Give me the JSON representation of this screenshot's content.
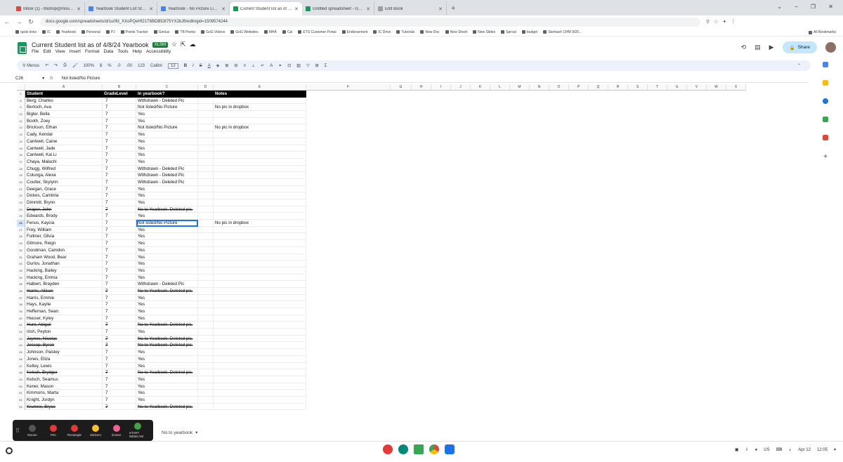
{
  "browser": {
    "tabs": [
      {
        "title": "Inbox (1) - lbishop@mountain…",
        "color": "#ea4335",
        "active": false
      },
      {
        "title": "Yearbook Student List Steps -",
        "color": "#4285f4",
        "active": false
      },
      {
        "title": "Yearbook - No Picture List - Go",
        "color": "#4285f4",
        "active": false
      },
      {
        "title": "Current Student list as of 4/8/2…",
        "color": "#0f9d58",
        "active": true
      },
      {
        "title": "Untitled spreadsheet - Google S",
        "color": "#0f9d58",
        "active": false
      },
      {
        "title": "Edit Book",
        "color": "#9e9e9e",
        "active": false
      }
    ],
    "url": "docs.google.com/spreadsheets/d/1u0fd_XXoPQeHf21T6BDB53t75YX2bJft/edit#gid=1509574244",
    "bookmarks": [
      "quick links",
      "IC",
      "Yearbook",
      "Personal",
      "PJ",
      "Points Tracker",
      "Genius",
      "TB Points",
      "GoG Videos",
      "GoG Websites",
      "MHA",
      "Cal",
      "ETS Customer Portal",
      "Endorsement",
      "IC Drive",
      "Tutorials",
      "New Doc",
      "New Sheet",
      "New Slides",
      "Sprout",
      "budget",
      "Stomach CHM 9/20..."
    ],
    "all_bookmarks": "All Bookmarks"
  },
  "doc": {
    "title": "Current Student list as of 4/8/24 Yearbook",
    "badge": "XLSM",
    "menus": [
      "File",
      "Edit",
      "View",
      "Insert",
      "Format",
      "Data",
      "Tools",
      "Help",
      "Accessibility"
    ],
    "share_label": "Share"
  },
  "toolbar": {
    "menus": "Menus",
    "zoom": "100%",
    "currency": "$",
    "percent": "%",
    "dec_less": ".0",
    "dec_more": ".00",
    "num": "123",
    "font": "Calibri",
    "font_size": "12"
  },
  "formula": {
    "cell_ref": "C26",
    "fx": "fx",
    "value": "Not listed/No Picture"
  },
  "columns": [
    "A",
    "B",
    "C",
    "D",
    "E",
    "F",
    "G",
    "H",
    "I",
    "J",
    "K",
    "L",
    "M",
    "N",
    "O",
    "P",
    "Q",
    "R",
    "S",
    "T",
    "U",
    "V",
    "W",
    "X"
  ],
  "header_row": {
    "num": "1",
    "cells": [
      "Student",
      "GradeLevel",
      "In yearbook?",
      "",
      "Notes"
    ]
  },
  "rows": [
    {
      "num": "8",
      "name": "Berg, Charles",
      "grade": "7",
      "yb": "Withdrawn - Deleted Pic",
      "notes": "",
      "strike": false
    },
    {
      "num": "9",
      "name": "Bertoch, Ava",
      "grade": "7",
      "yb": "Not listed/No Picture",
      "notes": "No pic in dropbox",
      "strike": false
    },
    {
      "num": "10",
      "name": "Bigler, Bella",
      "grade": "7",
      "yb": "Yes",
      "notes": "",
      "strike": false
    },
    {
      "num": "11",
      "name": "Booth, Zoey",
      "grade": "7",
      "yb": "Yes",
      "notes": "",
      "strike": false
    },
    {
      "num": "12",
      "name": "Brickson, Ethan",
      "grade": "7",
      "yb": "Not listed/No Picture",
      "notes": "No pic in dropbox",
      "strike": false
    },
    {
      "num": "13",
      "name": "Cady, Kendal",
      "grade": "7",
      "yb": "Yes",
      "notes": "",
      "strike": false
    },
    {
      "num": "14",
      "name": "Cantwell, Caine",
      "grade": "7",
      "yb": "Yes",
      "notes": "",
      "strike": false
    },
    {
      "num": "15",
      "name": "Cantwell, Jade",
      "grade": "7",
      "yb": "Yes",
      "notes": "",
      "strike": false
    },
    {
      "num": "16",
      "name": "Cantwell, Kai Li",
      "grade": "7",
      "yb": "Yes",
      "notes": "",
      "strike": false
    },
    {
      "num": "17",
      "name": "Chaya, Malachi",
      "grade": "7",
      "yb": "Yes",
      "notes": "",
      "strike": false
    },
    {
      "num": "18",
      "name": "Chugg, Wilfred",
      "grade": "7",
      "yb": "Withdrawn - Deleted Pic",
      "notes": "",
      "strike": false
    },
    {
      "num": "19",
      "name": "Colunga, Alexa",
      "grade": "7",
      "yb": "Withdrawn - Deleted Pic",
      "notes": "",
      "strike": false
    },
    {
      "num": "20",
      "name": "Coulter, Skylynn",
      "grade": "7",
      "yb": "Withdrawn - Deleted Pic",
      "notes": "",
      "strike": false
    },
    {
      "num": "21",
      "name": "Deegan, Grace",
      "grade": "7",
      "yb": "Yes",
      "notes": "",
      "strike": false
    },
    {
      "num": "22",
      "name": "Dickes, Cambria",
      "grade": "7",
      "yb": "Yes",
      "notes": "",
      "strike": false
    },
    {
      "num": "23",
      "name": "Dimmitt, Brynn",
      "grade": "7",
      "yb": "Yes",
      "notes": "",
      "strike": false
    },
    {
      "num": "24",
      "name": "Draper, John",
      "grade": "7",
      "yb": "No to Yearbook. Deleted pic.",
      "notes": "",
      "strike": true
    },
    {
      "num": "25",
      "name": "Edwards, Brody",
      "grade": "7",
      "yb": "Yes",
      "notes": "",
      "strike": false
    },
    {
      "num": "26",
      "name": "Fenus, Kaycia",
      "grade": "7",
      "yb": "Not listed/No Picture",
      "notes": "No pic in dropbox",
      "strike": false
    },
    {
      "num": "27",
      "name": "Frey, William",
      "grade": "7",
      "yb": "Yes",
      "notes": "",
      "strike": false
    },
    {
      "num": "28",
      "name": "Fullmer, Olivia",
      "grade": "7",
      "yb": "Yes",
      "notes": "",
      "strike": false
    },
    {
      "num": "29",
      "name": "Gilmore, Reign",
      "grade": "7",
      "yb": "Yes",
      "notes": "",
      "strike": false
    },
    {
      "num": "30",
      "name": "Goodman, Camdon",
      "grade": "7",
      "yb": "Yes",
      "notes": "",
      "strike": false
    },
    {
      "num": "31",
      "name": "Graham Wood, Bear",
      "grade": "7",
      "yb": "Yes",
      "notes": "",
      "strike": false
    },
    {
      "num": "32",
      "name": "Gurlov, Jonathan",
      "grade": "7",
      "yb": "Yes",
      "notes": "",
      "strike": false
    },
    {
      "num": "33",
      "name": "Hacking, Bailey",
      "grade": "7",
      "yb": "Yes",
      "notes": "",
      "strike": false
    },
    {
      "num": "34",
      "name": "Hacking, Emma",
      "grade": "7",
      "yb": "Yes",
      "notes": "",
      "strike": false
    },
    {
      "num": "35",
      "name": "Halbert, Brayden",
      "grade": "7",
      "yb": "Withdrawn - Deleted Pic",
      "notes": "",
      "strike": false
    },
    {
      "num": "36",
      "name": "Harris, Allison",
      "grade": "7",
      "yb": "No to Yearbook. Deleted pic.",
      "notes": "",
      "strike": true
    },
    {
      "num": "37",
      "name": "Harris, Emmie",
      "grade": "7",
      "yb": "Yes",
      "notes": "",
      "strike": false
    },
    {
      "num": "38",
      "name": "Hays, Kaylie",
      "grade": "7",
      "yb": "Yes",
      "notes": "",
      "strike": false
    },
    {
      "num": "39",
      "name": "Heffernan, Sean",
      "grade": "7",
      "yb": "Yes",
      "notes": "",
      "strike": false
    },
    {
      "num": "40",
      "name": "Heuser, Kyley",
      "grade": "7",
      "yb": "Yes",
      "notes": "",
      "strike": false
    },
    {
      "num": "41",
      "name": "Hunt, Abigail",
      "grade": "7",
      "yb": "No to Yearbook. Deleted pic.",
      "notes": "",
      "strike": true
    },
    {
      "num": "42",
      "name": "Irish, Peyton",
      "grade": "7",
      "yb": "Yes",
      "notes": "",
      "strike": false
    },
    {
      "num": "43",
      "name": "Jaynes, Nicolas",
      "grade": "7",
      "yb": "No to Yearbook. Deleted pic.",
      "notes": "",
      "strike": true
    },
    {
      "num": "44",
      "name": "Jessop, Byron",
      "grade": "7",
      "yb": "No to Yearbook. Deleted pic.",
      "notes": "",
      "strike": true
    },
    {
      "num": "45",
      "name": "Johnson, Paisley",
      "grade": "7",
      "yb": "Yes",
      "notes": "",
      "strike": false
    },
    {
      "num": "46",
      "name": "Jones, Eliza",
      "grade": "7",
      "yb": "Yes",
      "notes": "",
      "strike": false
    },
    {
      "num": "47",
      "name": "Kelley, Lewis",
      "grade": "7",
      "yb": "Yes",
      "notes": "",
      "strike": false
    },
    {
      "num": "48",
      "name": "Kelsch, Brydger",
      "grade": "7",
      "yb": "No to Yearbook. Deleted pic.",
      "notes": "",
      "strike": true
    },
    {
      "num": "49",
      "name": "Kelsch, Seamus",
      "grade": "7",
      "yb": "Yes",
      "notes": "",
      "strike": false
    },
    {
      "num": "50",
      "name": "Kener, Mason",
      "grade": "7",
      "yb": "Yes",
      "notes": "",
      "strike": false
    },
    {
      "num": "51",
      "name": "Kimmons, Marta",
      "grade": "7",
      "yb": "Yes",
      "notes": "",
      "strike": false
    },
    {
      "num": "52",
      "name": "Knight, Jordyn",
      "grade": "7",
      "yb": "Yes",
      "notes": "",
      "strike": false
    },
    {
      "num": "53",
      "name": "Krumrei, Bryce",
      "grade": "7",
      "yb": "No to Yearbook. Deleted pic.",
      "notes": "",
      "strike": true
    }
  ],
  "sheet_tab": "No to yearbook",
  "zoom_tools": [
    {
      "label": "Mouse",
      "color": "#555"
    },
    {
      "label": "Pen",
      "color": "#e53935"
    },
    {
      "label": "Rectangle",
      "color": "#e53935"
    },
    {
      "label": "Stickers",
      "color": "#fbc02d"
    },
    {
      "label": "Eraser",
      "color": "#f06292"
    },
    {
      "label": "START WEBCAM",
      "color": "#43a047"
    }
  ],
  "tray": {
    "locale": "US",
    "date": "Apr 12",
    "time": "12:05"
  }
}
